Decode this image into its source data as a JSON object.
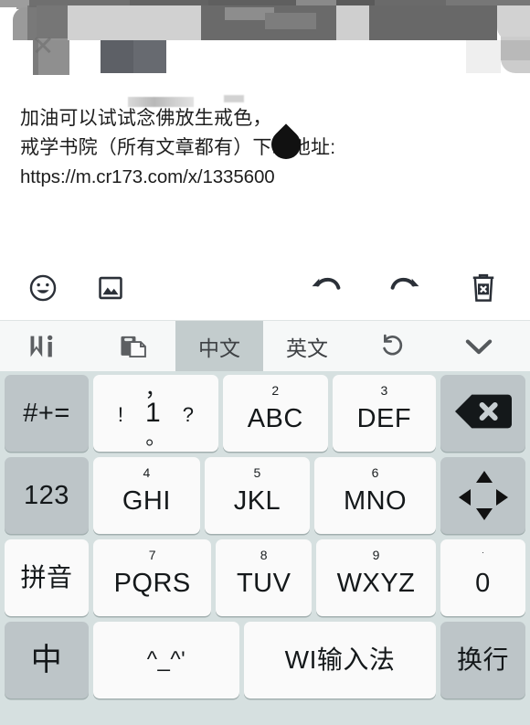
{
  "message": {
    "lines": [
      "加油可以试试念佛放生戒色，",
      "戒学书院（所有文章都有）下载地址:",
      "https://m.cr173.com/x/1335600"
    ]
  },
  "editor_toolbar": {
    "emoji_icon": "smiley-icon",
    "image_icon": "image-icon",
    "undo_icon": "undo-icon",
    "redo_icon": "redo-icon",
    "delete_icon": "trash-delete-icon"
  },
  "ime_bar": {
    "logo_icon": "wi-logo-icon",
    "clipboard_icon": "clipboard-copy-icon",
    "tab_chinese": "中文",
    "tab_english": "英文",
    "refresh_icon": "undo-arrow-icon",
    "collapse_icon": "chevron-down-icon",
    "active_tab": "中文"
  },
  "keyboard": {
    "rows": [
      {
        "keys": [
          {
            "name": "symbols-key",
            "label": "#+=",
            "type": "fn"
          },
          {
            "name": "key-1",
            "label": "1",
            "type": "multi",
            "top": "，",
            "bottom": "。",
            "left": "!",
            "right": "?"
          },
          {
            "name": "key-2-abc",
            "label": "ABC",
            "sup": "2",
            "type": "letter"
          },
          {
            "name": "key-3-def",
            "label": "DEF",
            "sup": "3",
            "type": "letter"
          },
          {
            "name": "backspace-key",
            "label": "",
            "type": "fn",
            "icon": "backspace-icon"
          }
        ]
      },
      {
        "keys": [
          {
            "name": "numbers-key",
            "label": "123",
            "type": "fn"
          },
          {
            "name": "key-4-ghi",
            "label": "GHI",
            "sup": "4",
            "type": "letter"
          },
          {
            "name": "key-5-jkl",
            "label": "JKL",
            "sup": "5",
            "type": "letter"
          },
          {
            "name": "key-6-mno",
            "label": "MNO",
            "sup": "6",
            "type": "letter"
          },
          {
            "name": "arrow-pad-key",
            "label": "",
            "type": "fn",
            "icon": "arrow-pad-icon"
          }
        ]
      },
      {
        "keys": [
          {
            "name": "pinyin-key",
            "label": "拼音",
            "type": "letter"
          },
          {
            "name": "key-7-pqrs",
            "label": "PQRS",
            "sup": "7",
            "type": "letter"
          },
          {
            "name": "key-8-tuv",
            "label": "TUV",
            "sup": "8",
            "type": "letter"
          },
          {
            "name": "key-9-wxyz",
            "label": "WXYZ",
            "sup": "9",
            "type": "letter"
          },
          {
            "name": "key-0",
            "label": "0",
            "sup": "·",
            "type": "letter"
          }
        ]
      },
      {
        "keys": [
          {
            "name": "lang-toggle-key",
            "label": "中",
            "type": "fn"
          },
          {
            "name": "emoticon-key",
            "label": "^_^'",
            "type": "letter"
          },
          {
            "name": "space-key",
            "label": "WI输入法",
            "type": "letter"
          },
          {
            "name": "enter-key",
            "label": "换行",
            "type": "fn"
          }
        ]
      }
    ]
  }
}
